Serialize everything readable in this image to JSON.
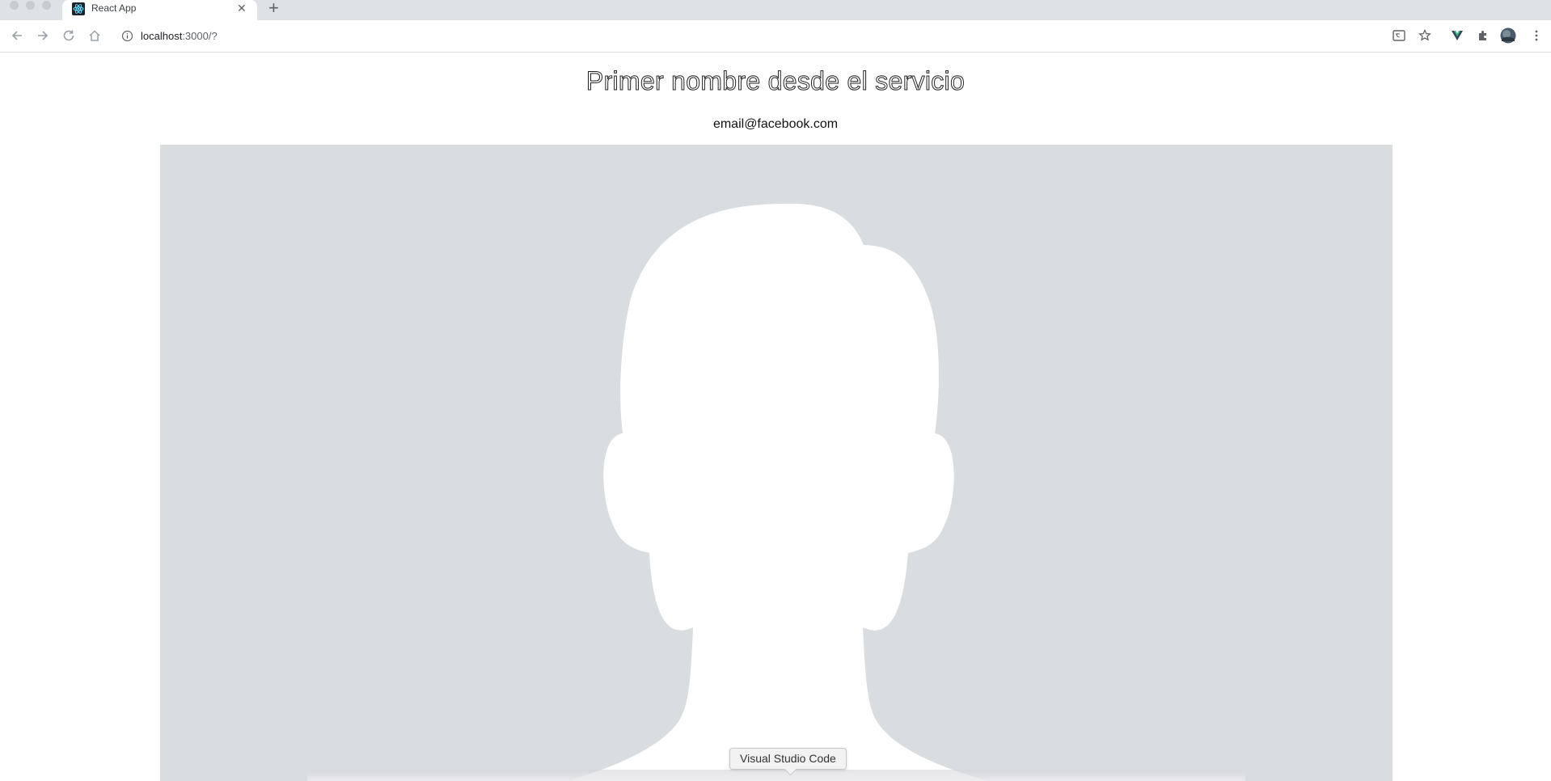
{
  "browser": {
    "tab": {
      "title": "React App"
    },
    "new_tab_label": "+",
    "url": {
      "host": "localhost",
      "path": ":3000/?"
    }
  },
  "page": {
    "title": "Primer nombre desde el servicio",
    "email": "email@facebook.com",
    "avatar_background": "#dadde0"
  },
  "tooltip": {
    "label": "Visual Studio Code"
  }
}
